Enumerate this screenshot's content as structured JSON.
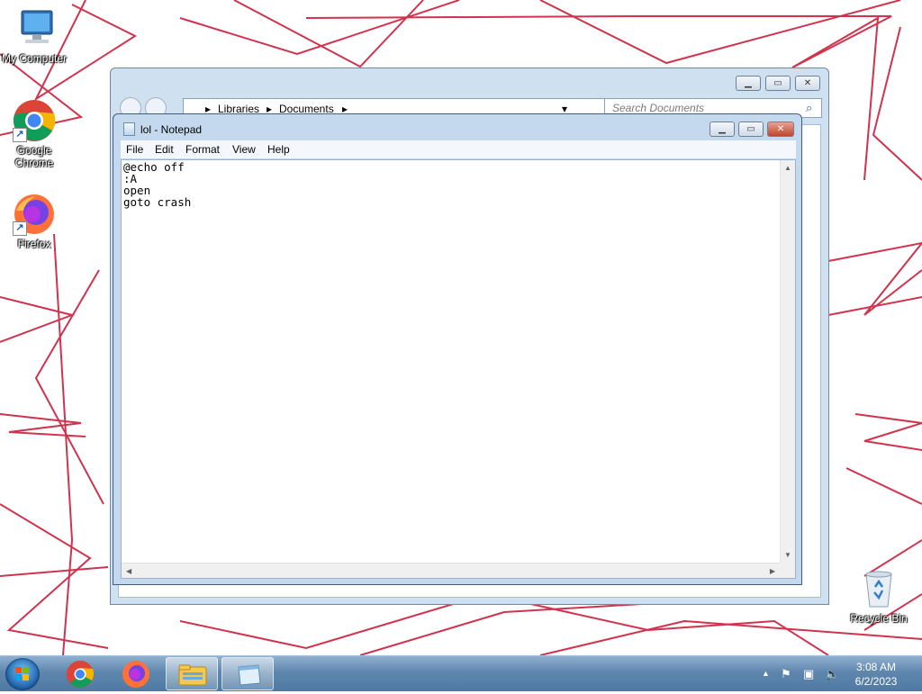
{
  "desktop": {
    "icons": [
      {
        "label": "My Computer",
        "icon": "computer-icon"
      },
      {
        "label": "Google Chrome",
        "icon": "chrome-icon"
      },
      {
        "label": "Firefox",
        "icon": "firefox-icon"
      },
      {
        "label": "Recycle Bin",
        "icon": "recycle-bin-icon"
      }
    ]
  },
  "explorer": {
    "breadcrumb": [
      "Libraries",
      "Documents"
    ],
    "search_placeholder": "Search Documents"
  },
  "notepad": {
    "title": "lol - Notepad",
    "menu": [
      "File",
      "Edit",
      "Format",
      "View",
      "Help"
    ],
    "content": "@echo off\n:A\nopen\ngoto crash"
  },
  "taskbar": {
    "pinned": [
      "start-orb",
      "chrome-icon",
      "firefox-icon",
      "explorer-icon",
      "notepad-icon"
    ],
    "tray_icons": [
      "show-hidden-icon",
      "action-center-icon",
      "network-icon",
      "volume-muted-icon"
    ],
    "time": "3:08 AM",
    "date": "6/2/2023"
  },
  "colors": {
    "wallpaper_lines": "#c8102e",
    "taskbar": "#5f86ad",
    "window_frame": "#c5d9ee"
  }
}
